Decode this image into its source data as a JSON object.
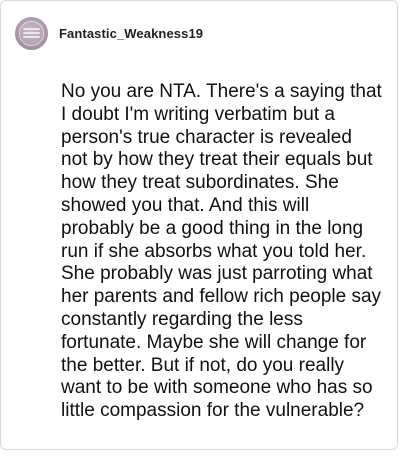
{
  "comment": {
    "username": "Fantastic_Weakness19",
    "avatar_icon": "user-avatar-icon",
    "text": "No you are NTA. There's a saying that I doubt I'm writing verbatim but a person's true character is revealed not by how they treat their equals but how they treat subordinates. She showed you that. And this will probably be a good thing in the long run if she absorbs what you told her. She probably was just parroting what her parents and fellow rich people say constantly regarding the less fortunate. Maybe she will change for the better. But if not, do you really want to be with someone who has so little compassion for the vulnerable?"
  }
}
